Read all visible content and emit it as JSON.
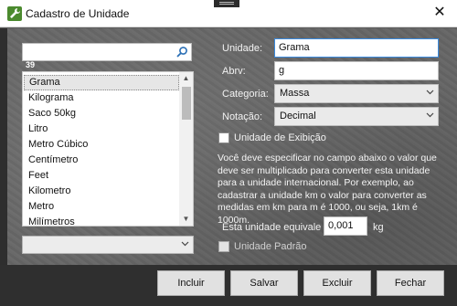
{
  "window": {
    "title": "Cadastro de Unidade",
    "close_glyph": "✕",
    "icon": "wrench-icon"
  },
  "search": {
    "value": "",
    "placeholder": "",
    "icon": "search-icon",
    "count": "39"
  },
  "list": {
    "items": [
      "Grama",
      "Kilograma",
      "Saco 50kg",
      "Litro",
      "Metro Cúbico",
      "Centímetro",
      "Feet",
      "Kilometro",
      "Metro",
      "Milímetros"
    ],
    "selected_index": 0
  },
  "bottom_combo": {
    "value": ""
  },
  "form": {
    "unidade_label": "Unidade:",
    "unidade_value": "Grama",
    "abrv_label": "Abrv:",
    "abrv_value": "g",
    "categoria_label": "Categoria:",
    "categoria_value": "Massa",
    "notacao_label": "Notação:",
    "notacao_value": "Decimal",
    "exibicao_label": "Unidade de Exibição",
    "exibicao_checked": false,
    "info_text": "Você deve especificar no campo abaixo o valor que deve ser multiplicado para converter esta unidade para a unidade internacional. Por exemplo, ao cadastrar a unidade km o valor para converter as medidas em km para m é 1000, ou seja, 1km é 1000m.",
    "equivale_label": "Esta unidade equivale a",
    "equivale_value": "0,001",
    "equivale_unit": "kg",
    "padrao_label": "Unidade Padrão",
    "padrao_checked": false
  },
  "buttons": {
    "incluir": "Incluir",
    "salvar": "Salvar",
    "excluir": "Excluir",
    "fechar": "Fechar"
  }
}
